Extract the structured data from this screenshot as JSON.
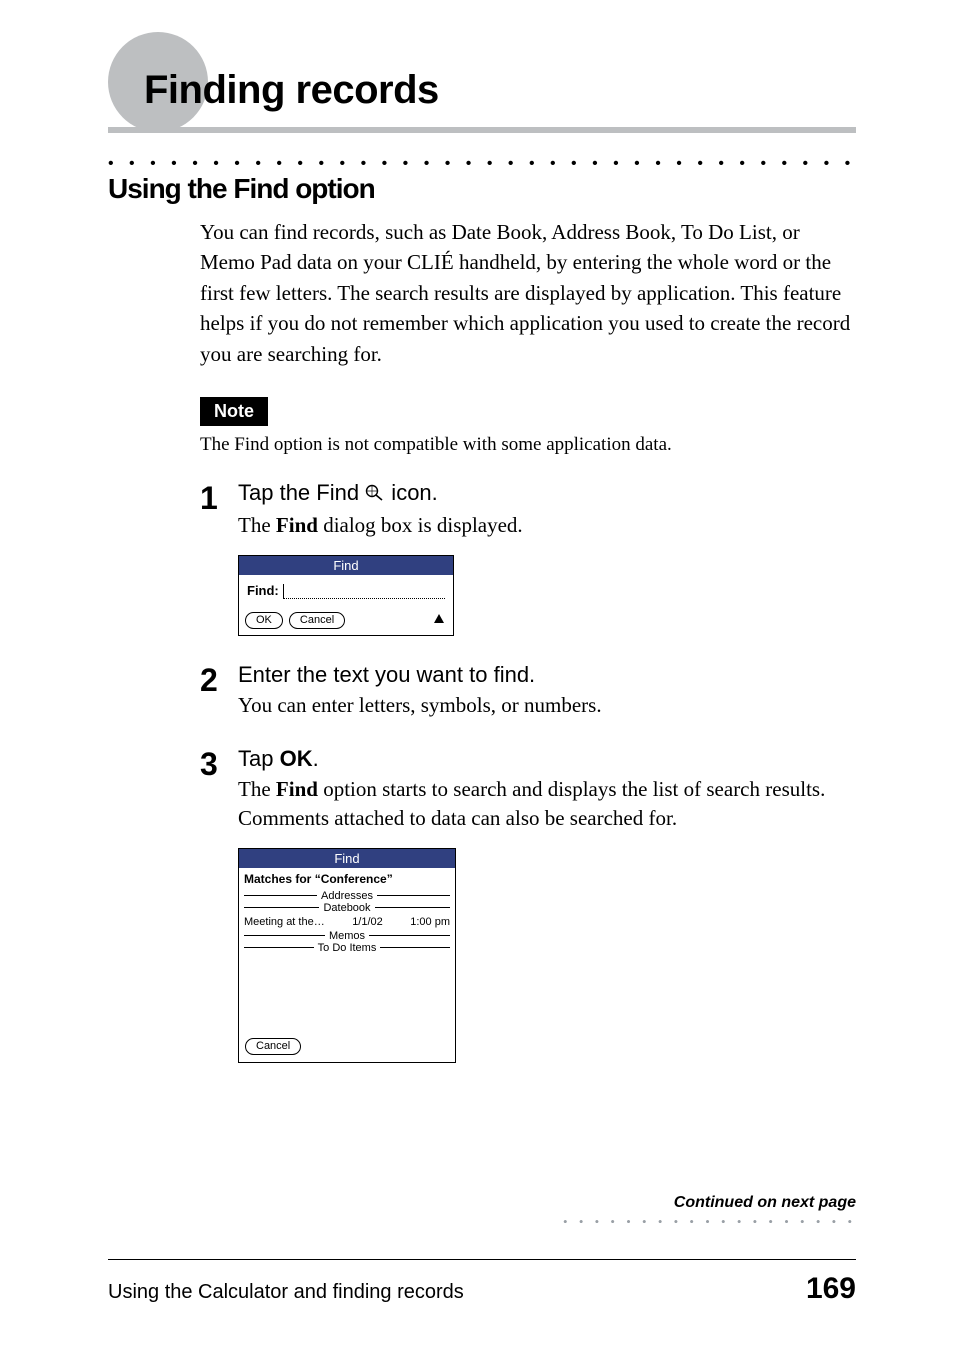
{
  "chapter_title": "Finding records",
  "section_heading": "Using the Find option",
  "intro_paragraph": "You can find records, such as Date Book, Address Book, To Do List, or Memo Pad data on your CLIÉ handheld, by entering the whole word or the first few letters. The search results are displayed by application. This feature helps if you do not remember which application you used to create the record you are searching for.",
  "note_label": "Note",
  "note_text": "The Find option is not compatible with some application data.",
  "steps": [
    {
      "num": "1",
      "title_before": "Tap the Find ",
      "title_after": " icon.",
      "desc_before": "The ",
      "desc_bold": "Find",
      "desc_after": " dialog box is displayed."
    },
    {
      "num": "2",
      "title": "Enter the text you want to find.",
      "desc": "You can enter letters, symbols, or numbers."
    },
    {
      "num": "3",
      "title_before": "Tap ",
      "title_bold": "OK",
      "title_after": ".",
      "desc_before": "The ",
      "desc_bold": "Find",
      "desc_after": " option starts to search and displays the list of search results. Comments attached to data can also be searched for."
    }
  ],
  "dialog_small": {
    "title": "Find",
    "find_label": "Find:",
    "ok": "OK",
    "cancel": "Cancel"
  },
  "dialog_large": {
    "title": "Find",
    "matches_prefix": "Matches for ",
    "query": "“Conference”",
    "categories": [
      "Addresses",
      "Datebook",
      "Memos",
      "To Do Items"
    ],
    "result": {
      "text": "Meeting at the…",
      "date": "1/1/02",
      "time": "1:00 pm"
    },
    "cancel": "Cancel"
  },
  "continued": "Continued on next page",
  "footer": {
    "left": "Using the Calculator and finding records",
    "page": "169"
  }
}
